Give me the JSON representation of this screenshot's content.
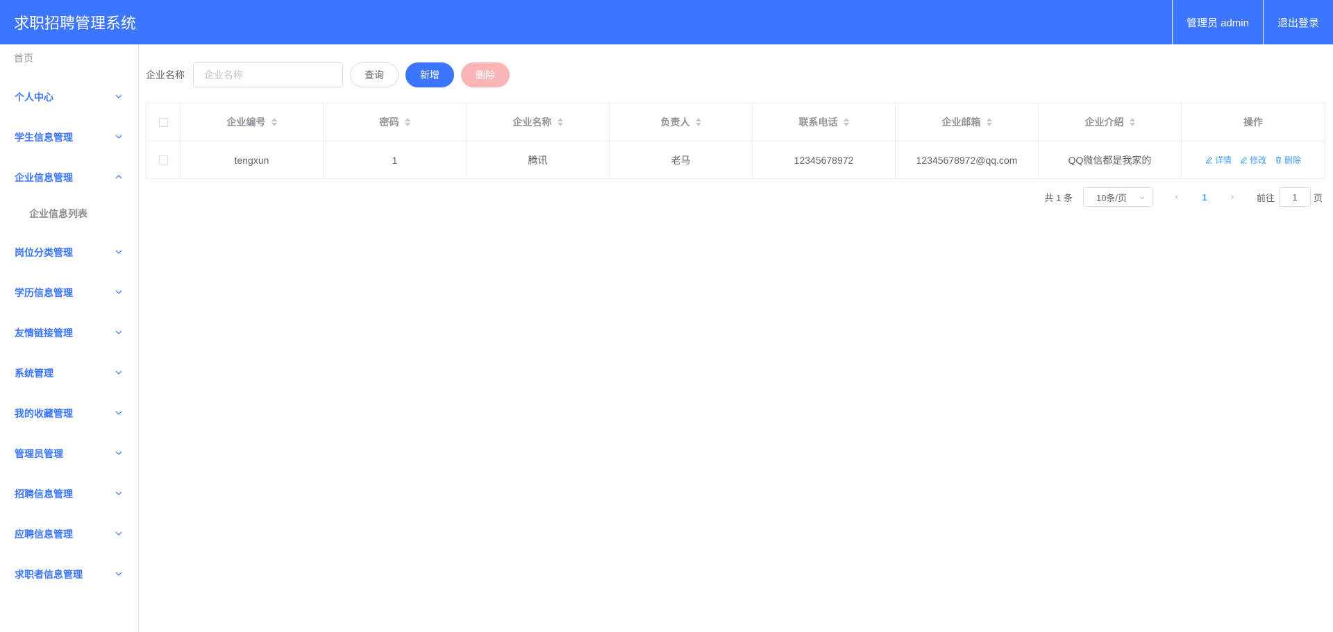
{
  "app": {
    "title": "求职招聘管理系统",
    "user_label": "管理员 admin",
    "logout_label": "退出登录"
  },
  "sidebar": {
    "home_label": "首页",
    "items": [
      {
        "label": "个人中心",
        "expanded": false
      },
      {
        "label": "学生信息管理",
        "expanded": false
      },
      {
        "label": "企业信息管理",
        "expanded": true,
        "children": [
          {
            "label": "企业信息列表"
          }
        ]
      },
      {
        "label": "岗位分类管理",
        "expanded": false
      },
      {
        "label": "学历信息管理",
        "expanded": false
      },
      {
        "label": "友情链接管理",
        "expanded": false
      },
      {
        "label": "系统管理",
        "expanded": false
      },
      {
        "label": "我的收藏管理",
        "expanded": false
      },
      {
        "label": "管理员管理",
        "expanded": false
      },
      {
        "label": "招聘信息管理",
        "expanded": false
      },
      {
        "label": "应聘信息管理",
        "expanded": false
      },
      {
        "label": "求职者信息管理",
        "expanded": false
      }
    ]
  },
  "search": {
    "label": "企业名称",
    "placeholder": "企业名称",
    "value": "",
    "query_label": "查询",
    "add_label": "新增",
    "delete_label": "删除"
  },
  "table": {
    "columns": [
      "企业编号",
      "密码",
      "企业名称",
      "负责人",
      "联系电话",
      "企业邮箱",
      "企业介绍",
      "操作"
    ],
    "rows": [
      {
        "cells": [
          "tengxun",
          "1",
          "腾讯",
          "老马",
          "12345678972",
          "12345678972@qq.com",
          "QQ微信都是我家的"
        ],
        "actions": [
          "详情",
          "修改",
          "删除"
        ]
      }
    ]
  },
  "pagination": {
    "total_label": "共 1 条",
    "page_size_label": "10条/页",
    "current_page": "1",
    "goto_prefix": "前往",
    "goto_value": "1",
    "goto_suffix": "页"
  },
  "colors": {
    "primary": "#3a76ff",
    "danger_light": "#fab6b6",
    "link": "#409eff"
  }
}
